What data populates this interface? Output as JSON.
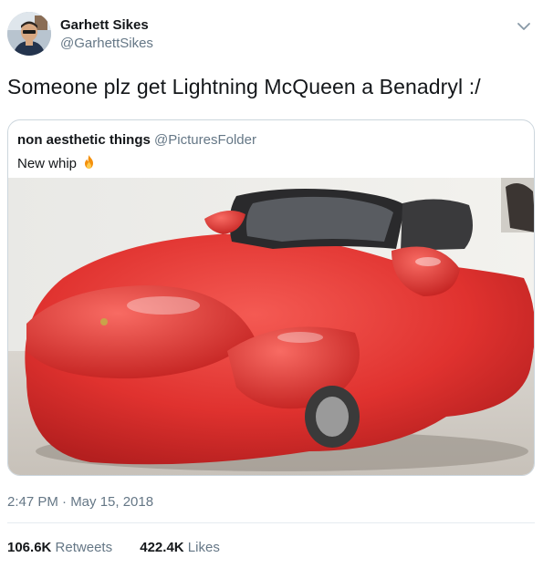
{
  "tweet": {
    "author": {
      "display_name": "Garhett Sikes",
      "handle": "@GarhettSikes"
    },
    "text": "Someone plz get Lightning McQueen a Benadryl :/",
    "timestamp": "2:47 PM · May 15, 2018",
    "menu_icon": "chevron-down-icon"
  },
  "quoted_tweet": {
    "display_name": "non aesthetic things",
    "handle": "@PicturesFolder",
    "text": "New whip",
    "emoji_icon": "fire-icon"
  },
  "stats": {
    "retweets_count": "106.6K",
    "retweets_label": "Retweets",
    "likes_count": "422.4K",
    "likes_label": "Likes"
  },
  "colors": {
    "text_primary": "#14171a",
    "text_secondary": "#657786",
    "border": "#ccd6dd",
    "accent_blue": "#1da1f2",
    "car_red": "#e0322f"
  }
}
